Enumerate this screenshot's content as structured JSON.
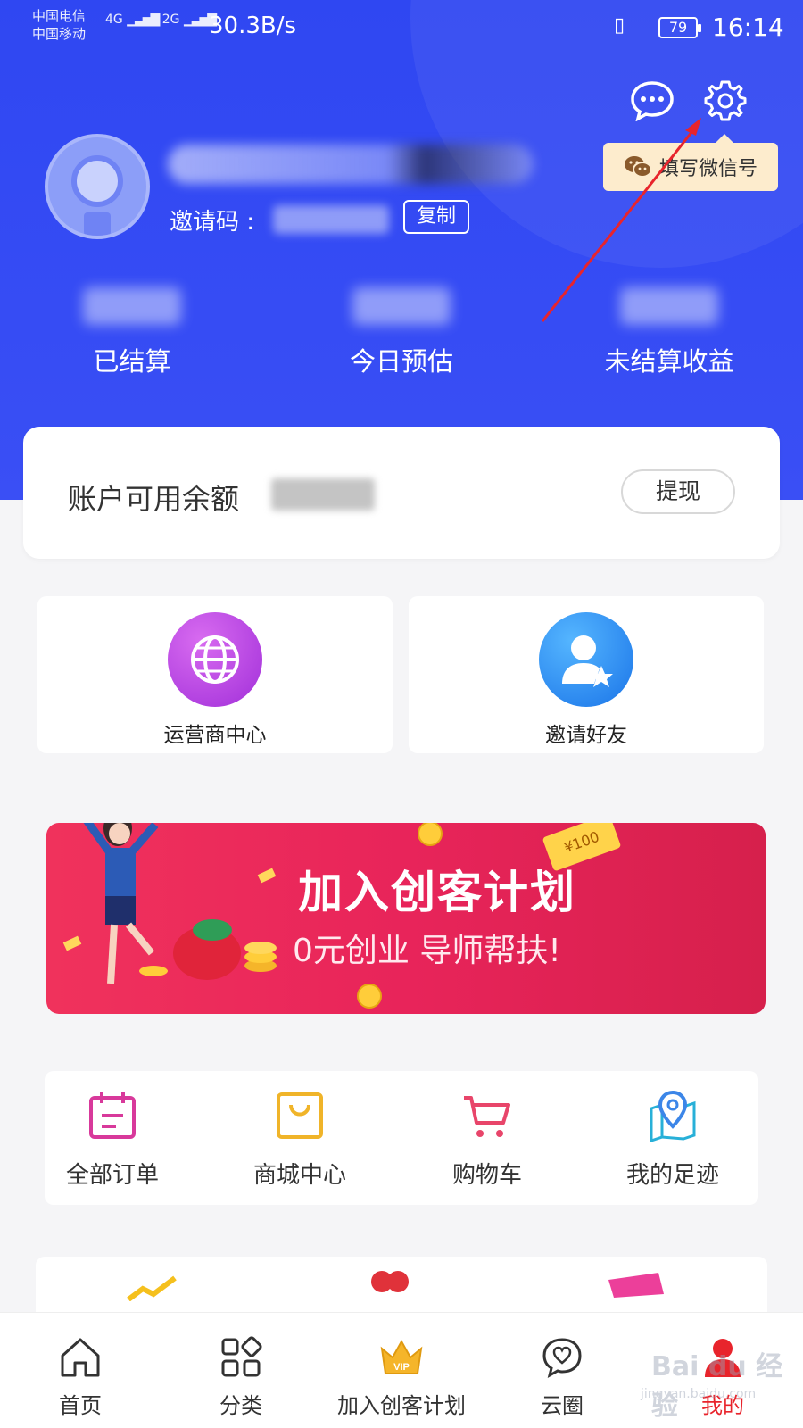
{
  "status_bar": {
    "carrier_1": "中国电信",
    "carrier_2": "中国移动",
    "signal_1": "4G",
    "signal_2": "2G",
    "net_speed": "30.3B/s",
    "battery": "79",
    "time": "16:14"
  },
  "header": {
    "wechat_tip": "填写微信号",
    "invite_label": "邀请码 :",
    "copy_label": "复制",
    "stats": [
      {
        "label": "已结算"
      },
      {
        "label": "今日预估"
      },
      {
        "label": "未结算收益"
      }
    ]
  },
  "balance": {
    "label": "账户可用余额",
    "withdraw_label": "提现"
  },
  "features": [
    {
      "label": "运营商中心",
      "icon": "globe-icon"
    },
    {
      "label": "邀请好友",
      "icon": "user-star-icon"
    }
  ],
  "banner": {
    "title": "加入创客计划",
    "subtitle": "0元创业 导师帮扶!",
    "ticket_label": "¥100"
  },
  "menu": [
    {
      "label": "全部订单",
      "icon": "calendar-icon"
    },
    {
      "label": "商城中心",
      "icon": "shopping-bag-icon"
    },
    {
      "label": "购物车",
      "icon": "cart-icon"
    },
    {
      "label": "我的足迹",
      "icon": "map-pin-icon"
    }
  ],
  "tabbar": [
    {
      "label": "首页",
      "icon": "home-icon"
    },
    {
      "label": "分类",
      "icon": "grid-icon"
    },
    {
      "label": "加入创客计划",
      "icon": "crown-icon"
    },
    {
      "label": "云圈",
      "icon": "chat-heart-icon"
    },
    {
      "label": "我的",
      "icon": "user-icon"
    }
  ],
  "watermark": {
    "text": "Bai du 经验",
    "sub": "jingyan.baidu.com"
  },
  "colors": {
    "header_blue": "#2f47f2",
    "active_red": "#e8242c",
    "banner_red": "#e8245a",
    "tip_bg": "#fdeccd"
  }
}
